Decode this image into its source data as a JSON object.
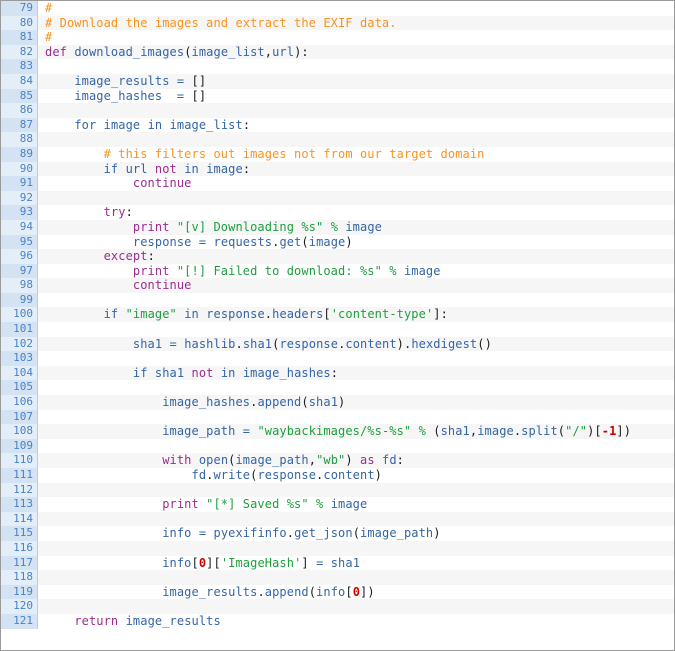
{
  "editor": {
    "title": "python-code-listing",
    "language": "Python",
    "first_line_number": 79,
    "last_line_number": 121,
    "colors": {
      "comment": "#f7941e",
      "keyword": "#9b2d8f",
      "string": "#1e9e3e",
      "number": "#cc0000",
      "name": "#3465a4",
      "plain": "#1b1b1b",
      "gutter_text": "#4a82c4",
      "gutter_band_odd": "#d3e3f3",
      "gutter_band_even": "#e4eef9",
      "row_band_odd": "#ffffff",
      "row_band_even": "#f6f6f6",
      "border": "#9a9a9a"
    }
  },
  "lines": [
    {
      "num": "79",
      "text": "#",
      "tokens": [
        {
          "t": "#",
          "c": "comment"
        }
      ]
    },
    {
      "num": "80",
      "text": "# Download the images and extract the EXIF data.",
      "tokens": [
        {
          "t": "# Download the images and extract the EXIF data.",
          "c": "comment"
        }
      ]
    },
    {
      "num": "81",
      "text": "#",
      "tokens": [
        {
          "t": "#",
          "c": "comment"
        }
      ]
    },
    {
      "num": "82",
      "text": "def download_images(image_list,url):",
      "tokens": [
        {
          "t": "def",
          "c": "keyword"
        },
        {
          "t": " ",
          "c": "plain"
        },
        {
          "t": "download_images",
          "c": "func"
        },
        {
          "t": "(",
          "c": "punct"
        },
        {
          "t": "image_list",
          "c": "name"
        },
        {
          "t": ",",
          "c": "punct"
        },
        {
          "t": "url",
          "c": "name"
        },
        {
          "t": "):",
          "c": "punct"
        }
      ]
    },
    {
      "num": "83",
      "text": "",
      "tokens": []
    },
    {
      "num": "84",
      "text": "    image_results = []",
      "tokens": [
        {
          "t": "    ",
          "c": "plain"
        },
        {
          "t": "image_results",
          "c": "name"
        },
        {
          "t": " ",
          "c": "plain"
        },
        {
          "t": "=",
          "c": "op"
        },
        {
          "t": " ",
          "c": "plain"
        },
        {
          "t": "[]",
          "c": "punct"
        }
      ]
    },
    {
      "num": "85",
      "text": "    image_hashes  = []",
      "tokens": [
        {
          "t": "    ",
          "c": "plain"
        },
        {
          "t": "image_hashes",
          "c": "name"
        },
        {
          "t": "  ",
          "c": "plain"
        },
        {
          "t": "=",
          "c": "op"
        },
        {
          "t": " ",
          "c": "plain"
        },
        {
          "t": "[]",
          "c": "punct"
        }
      ]
    },
    {
      "num": "86",
      "text": "",
      "tokens": []
    },
    {
      "num": "87",
      "text": "    for image in image_list:",
      "tokens": [
        {
          "t": "    ",
          "c": "plain"
        },
        {
          "t": "for",
          "c": "builtin"
        },
        {
          "t": " ",
          "c": "plain"
        },
        {
          "t": "image",
          "c": "name"
        },
        {
          "t": " ",
          "c": "plain"
        },
        {
          "t": "in",
          "c": "builtin"
        },
        {
          "t": " ",
          "c": "plain"
        },
        {
          "t": "image_list",
          "c": "name"
        },
        {
          "t": ":",
          "c": "punct"
        }
      ]
    },
    {
      "num": "88",
      "text": "",
      "tokens": []
    },
    {
      "num": "89",
      "text": "        # this filters out images not from our target domain",
      "tokens": [
        {
          "t": "        ",
          "c": "plain"
        },
        {
          "t": "# this filters out images not from our target domain",
          "c": "comment"
        }
      ]
    },
    {
      "num": "90",
      "text": "        if url not in image:",
      "tokens": [
        {
          "t": "        ",
          "c": "plain"
        },
        {
          "t": "if",
          "c": "builtin"
        },
        {
          "t": " ",
          "c": "plain"
        },
        {
          "t": "url",
          "c": "name"
        },
        {
          "t": " ",
          "c": "plain"
        },
        {
          "t": "not",
          "c": "keyword"
        },
        {
          "t": " ",
          "c": "plain"
        },
        {
          "t": "in",
          "c": "builtin"
        },
        {
          "t": " ",
          "c": "plain"
        },
        {
          "t": "image",
          "c": "name"
        },
        {
          "t": ":",
          "c": "punct"
        }
      ]
    },
    {
      "num": "91",
      "text": "            continue",
      "tokens": [
        {
          "t": "            ",
          "c": "plain"
        },
        {
          "t": "continue",
          "c": "keyword"
        }
      ]
    },
    {
      "num": "92",
      "text": "",
      "tokens": []
    },
    {
      "num": "93",
      "text": "        try:",
      "tokens": [
        {
          "t": "        ",
          "c": "plain"
        },
        {
          "t": "try",
          "c": "keyword"
        },
        {
          "t": ":",
          "c": "punct"
        }
      ]
    },
    {
      "num": "94",
      "text": "            print \"[v] Downloading %s\" % image",
      "tokens": [
        {
          "t": "            ",
          "c": "plain"
        },
        {
          "t": "print",
          "c": "keyword"
        },
        {
          "t": " ",
          "c": "plain"
        },
        {
          "t": "\"[v] Downloading %s\"",
          "c": "string"
        },
        {
          "t": " ",
          "c": "plain"
        },
        {
          "t": "%",
          "c": "string"
        },
        {
          "t": " ",
          "c": "plain"
        },
        {
          "t": "image",
          "c": "name"
        }
      ]
    },
    {
      "num": "95",
      "text": "            response = requests.get(image)",
      "tokens": [
        {
          "t": "            ",
          "c": "plain"
        },
        {
          "t": "response",
          "c": "name"
        },
        {
          "t": " ",
          "c": "plain"
        },
        {
          "t": "=",
          "c": "op"
        },
        {
          "t": " ",
          "c": "plain"
        },
        {
          "t": "requests",
          "c": "name"
        },
        {
          "t": ".",
          "c": "punct"
        },
        {
          "t": "get",
          "c": "func"
        },
        {
          "t": "(",
          "c": "punct"
        },
        {
          "t": "image",
          "c": "name"
        },
        {
          "t": ")",
          "c": "punct"
        }
      ]
    },
    {
      "num": "96",
      "text": "        except:",
      "tokens": [
        {
          "t": "        ",
          "c": "plain"
        },
        {
          "t": "except",
          "c": "keyword"
        },
        {
          "t": ":",
          "c": "punct"
        }
      ]
    },
    {
      "num": "97",
      "text": "            print \"[!] Failed to download: %s\" % image",
      "tokens": [
        {
          "t": "            ",
          "c": "plain"
        },
        {
          "t": "print",
          "c": "keyword"
        },
        {
          "t": " ",
          "c": "plain"
        },
        {
          "t": "\"[!] Failed to download: %s\"",
          "c": "string"
        },
        {
          "t": " ",
          "c": "plain"
        },
        {
          "t": "%",
          "c": "string"
        },
        {
          "t": " ",
          "c": "plain"
        },
        {
          "t": "image",
          "c": "name"
        }
      ]
    },
    {
      "num": "98",
      "text": "            continue",
      "tokens": [
        {
          "t": "            ",
          "c": "plain"
        },
        {
          "t": "continue",
          "c": "keyword"
        }
      ]
    },
    {
      "num": "99",
      "text": "",
      "tokens": []
    },
    {
      "num": "100",
      "text": "        if \"image\" in response.headers['content-type']:",
      "tokens": [
        {
          "t": "        ",
          "c": "plain"
        },
        {
          "t": "if",
          "c": "builtin"
        },
        {
          "t": " ",
          "c": "plain"
        },
        {
          "t": "\"image\"",
          "c": "string"
        },
        {
          "t": " ",
          "c": "plain"
        },
        {
          "t": "in",
          "c": "builtin"
        },
        {
          "t": " ",
          "c": "plain"
        },
        {
          "t": "response",
          "c": "name"
        },
        {
          "t": ".",
          "c": "punct"
        },
        {
          "t": "headers",
          "c": "name"
        },
        {
          "t": "[",
          "c": "punct"
        },
        {
          "t": "'content-type'",
          "c": "string"
        },
        {
          "t": "]:",
          "c": "punct"
        }
      ]
    },
    {
      "num": "101",
      "text": "",
      "tokens": []
    },
    {
      "num": "102",
      "text": "            sha1 = hashlib.sha1(response.content).hexdigest()",
      "tokens": [
        {
          "t": "            ",
          "c": "plain"
        },
        {
          "t": "sha1",
          "c": "name"
        },
        {
          "t": " ",
          "c": "plain"
        },
        {
          "t": "=",
          "c": "op"
        },
        {
          "t": " ",
          "c": "plain"
        },
        {
          "t": "hashlib",
          "c": "name"
        },
        {
          "t": ".",
          "c": "punct"
        },
        {
          "t": "sha1",
          "c": "func"
        },
        {
          "t": "(",
          "c": "punct"
        },
        {
          "t": "response",
          "c": "name"
        },
        {
          "t": ".",
          "c": "punct"
        },
        {
          "t": "content",
          "c": "name"
        },
        {
          "t": ")",
          "c": "punct"
        },
        {
          "t": ".",
          "c": "punct"
        },
        {
          "t": "hexdigest",
          "c": "func"
        },
        {
          "t": "()",
          "c": "punct"
        }
      ]
    },
    {
      "num": "103",
      "text": "",
      "tokens": []
    },
    {
      "num": "104",
      "text": "            if sha1 not in image_hashes:",
      "tokens": [
        {
          "t": "            ",
          "c": "plain"
        },
        {
          "t": "if",
          "c": "builtin"
        },
        {
          "t": " ",
          "c": "plain"
        },
        {
          "t": "sha1",
          "c": "name"
        },
        {
          "t": " ",
          "c": "plain"
        },
        {
          "t": "not",
          "c": "keyword"
        },
        {
          "t": " ",
          "c": "plain"
        },
        {
          "t": "in",
          "c": "builtin"
        },
        {
          "t": " ",
          "c": "plain"
        },
        {
          "t": "image_hashes",
          "c": "name"
        },
        {
          "t": ":",
          "c": "punct"
        }
      ]
    },
    {
      "num": "105",
      "text": "",
      "tokens": []
    },
    {
      "num": "106",
      "text": "                image_hashes.append(sha1)",
      "tokens": [
        {
          "t": "                ",
          "c": "plain"
        },
        {
          "t": "image_hashes",
          "c": "name"
        },
        {
          "t": ".",
          "c": "punct"
        },
        {
          "t": "append",
          "c": "func"
        },
        {
          "t": "(",
          "c": "punct"
        },
        {
          "t": "sha1",
          "c": "name"
        },
        {
          "t": ")",
          "c": "punct"
        }
      ]
    },
    {
      "num": "107",
      "text": "",
      "tokens": []
    },
    {
      "num": "108",
      "text": "                image_path = \"waybackimages/%s-%s\" % (sha1,image.split(\"/\")[-1])",
      "tokens": [
        {
          "t": "                ",
          "c": "plain"
        },
        {
          "t": "image_path",
          "c": "name"
        },
        {
          "t": " ",
          "c": "plain"
        },
        {
          "t": "=",
          "c": "op"
        },
        {
          "t": " ",
          "c": "plain"
        },
        {
          "t": "\"waybackimages/%s-%s\"",
          "c": "string"
        },
        {
          "t": " ",
          "c": "plain"
        },
        {
          "t": "%",
          "c": "string"
        },
        {
          "t": " ",
          "c": "plain"
        },
        {
          "t": "(",
          "c": "punct"
        },
        {
          "t": "sha1",
          "c": "name"
        },
        {
          "t": ",",
          "c": "punct"
        },
        {
          "t": "image",
          "c": "name"
        },
        {
          "t": ".",
          "c": "punct"
        },
        {
          "t": "split",
          "c": "func"
        },
        {
          "t": "(",
          "c": "punct"
        },
        {
          "t": "\"/\"",
          "c": "string"
        },
        {
          "t": ")[",
          "c": "punct"
        },
        {
          "t": "-1",
          "c": "number"
        },
        {
          "t": "])",
          "c": "punct"
        }
      ]
    },
    {
      "num": "109",
      "text": "",
      "tokens": []
    },
    {
      "num": "110",
      "text": "                with open(image_path,\"wb\") as fd:",
      "tokens": [
        {
          "t": "                ",
          "c": "plain"
        },
        {
          "t": "with",
          "c": "keyword"
        },
        {
          "t": " ",
          "c": "plain"
        },
        {
          "t": "open",
          "c": "builtin"
        },
        {
          "t": "(",
          "c": "punct"
        },
        {
          "t": "image_path",
          "c": "name"
        },
        {
          "t": ",",
          "c": "punct"
        },
        {
          "t": "\"wb\"",
          "c": "string"
        },
        {
          "t": ")",
          "c": "punct"
        },
        {
          "t": " ",
          "c": "plain"
        },
        {
          "t": "as",
          "c": "keyword"
        },
        {
          "t": " ",
          "c": "plain"
        },
        {
          "t": "fd",
          "c": "name"
        },
        {
          "t": ":",
          "c": "punct"
        }
      ]
    },
    {
      "num": "111",
      "text": "                    fd.write(response.content)",
      "tokens": [
        {
          "t": "                    ",
          "c": "plain"
        },
        {
          "t": "fd",
          "c": "name"
        },
        {
          "t": ".",
          "c": "punct"
        },
        {
          "t": "write",
          "c": "func"
        },
        {
          "t": "(",
          "c": "punct"
        },
        {
          "t": "response",
          "c": "name"
        },
        {
          "t": ".",
          "c": "punct"
        },
        {
          "t": "content",
          "c": "name"
        },
        {
          "t": ")",
          "c": "punct"
        }
      ]
    },
    {
      "num": "112",
      "text": "",
      "tokens": []
    },
    {
      "num": "113",
      "text": "                print \"[*] Saved %s\" % image",
      "tokens": [
        {
          "t": "                ",
          "c": "plain"
        },
        {
          "t": "print",
          "c": "keyword"
        },
        {
          "t": " ",
          "c": "plain"
        },
        {
          "t": "\"[*] Saved %s\"",
          "c": "string"
        },
        {
          "t": " ",
          "c": "plain"
        },
        {
          "t": "%",
          "c": "string"
        },
        {
          "t": " ",
          "c": "plain"
        },
        {
          "t": "image",
          "c": "name"
        }
      ]
    },
    {
      "num": "114",
      "text": "",
      "tokens": []
    },
    {
      "num": "115",
      "text": "                info = pyexifinfo.get_json(image_path)",
      "tokens": [
        {
          "t": "                ",
          "c": "plain"
        },
        {
          "t": "info",
          "c": "name"
        },
        {
          "t": " ",
          "c": "plain"
        },
        {
          "t": "=",
          "c": "op"
        },
        {
          "t": " ",
          "c": "plain"
        },
        {
          "t": "pyexifinfo",
          "c": "name"
        },
        {
          "t": ".",
          "c": "punct"
        },
        {
          "t": "get_json",
          "c": "func"
        },
        {
          "t": "(",
          "c": "punct"
        },
        {
          "t": "image_path",
          "c": "name"
        },
        {
          "t": ")",
          "c": "punct"
        }
      ]
    },
    {
      "num": "116",
      "text": "",
      "tokens": []
    },
    {
      "num": "117",
      "text": "                info[0]['ImageHash'] = sha1",
      "tokens": [
        {
          "t": "                ",
          "c": "plain"
        },
        {
          "t": "info",
          "c": "name"
        },
        {
          "t": "[",
          "c": "punct"
        },
        {
          "t": "0",
          "c": "number"
        },
        {
          "t": "][",
          "c": "punct"
        },
        {
          "t": "'ImageHash'",
          "c": "string"
        },
        {
          "t": "]",
          "c": "punct"
        },
        {
          "t": " ",
          "c": "plain"
        },
        {
          "t": "=",
          "c": "op"
        },
        {
          "t": " ",
          "c": "plain"
        },
        {
          "t": "sha1",
          "c": "name"
        }
      ]
    },
    {
      "num": "118",
      "text": "",
      "tokens": []
    },
    {
      "num": "119",
      "text": "                image_results.append(info[0])",
      "tokens": [
        {
          "t": "                ",
          "c": "plain"
        },
        {
          "t": "image_results",
          "c": "name"
        },
        {
          "t": ".",
          "c": "punct"
        },
        {
          "t": "append",
          "c": "func"
        },
        {
          "t": "(",
          "c": "punct"
        },
        {
          "t": "info",
          "c": "name"
        },
        {
          "t": "[",
          "c": "punct"
        },
        {
          "t": "0",
          "c": "number"
        },
        {
          "t": "])",
          "c": "punct"
        }
      ]
    },
    {
      "num": "120",
      "text": "",
      "tokens": []
    },
    {
      "num": "121",
      "text": "    return image_results",
      "tokens": [
        {
          "t": "    ",
          "c": "plain"
        },
        {
          "t": "return",
          "c": "keyword"
        },
        {
          "t": " ",
          "c": "plain"
        },
        {
          "t": "image_results",
          "c": "name"
        }
      ]
    }
  ]
}
